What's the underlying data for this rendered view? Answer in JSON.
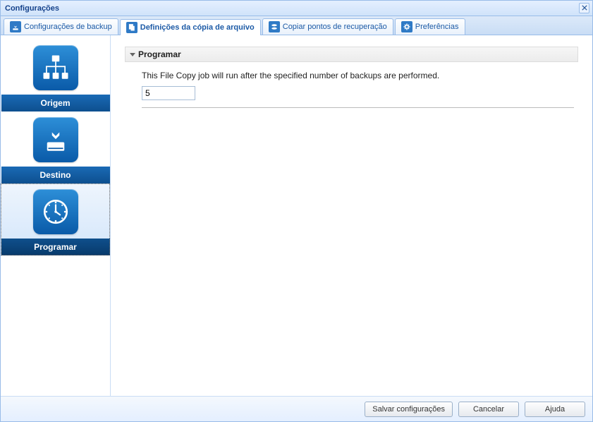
{
  "window": {
    "title": "Configurações"
  },
  "tabs": [
    {
      "label": "Configurações de backup"
    },
    {
      "label": "Definições da cópia de arquivo"
    },
    {
      "label": "Copiar pontos de recuperação"
    },
    {
      "label": "Preferências"
    }
  ],
  "sidebar": {
    "items": [
      {
        "label": "Origem"
      },
      {
        "label": "Destino"
      },
      {
        "label": "Programar"
      }
    ]
  },
  "content": {
    "section_title": "Programar",
    "description": "This File Copy job will run after the specified number of backups are performed.",
    "backup_count_value": "5"
  },
  "footer": {
    "save_label": "Salvar configurações",
    "cancel_label": "Cancelar",
    "help_label": "Ajuda"
  }
}
